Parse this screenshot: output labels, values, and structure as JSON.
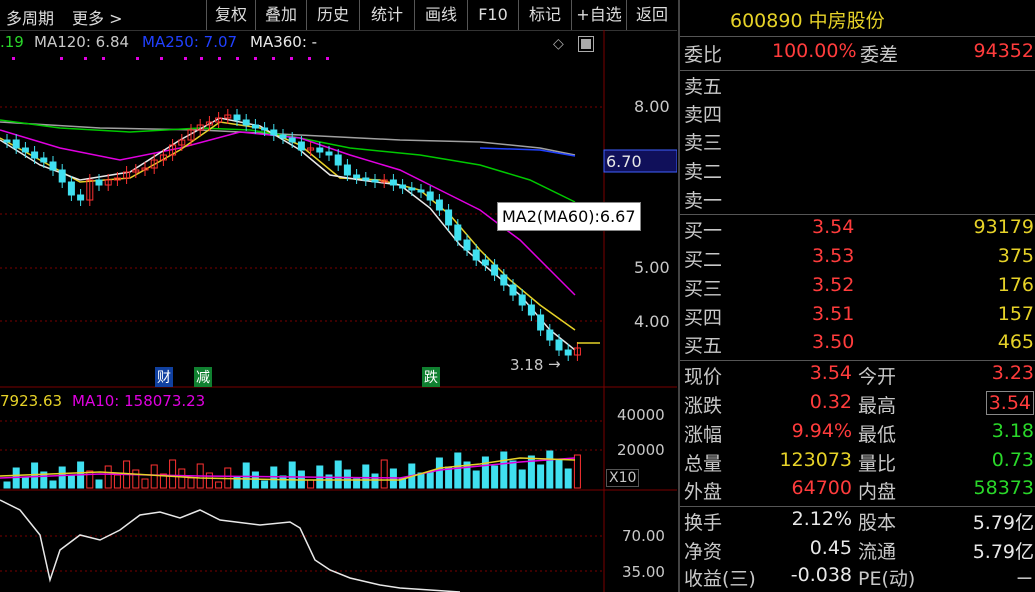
{
  "toolbar": {
    "period": "多周期",
    "more": "更多 >",
    "buttons": [
      "复权",
      "叠加",
      "历史",
      "统计",
      "画线",
      "F10",
      "标记",
      "+自选",
      "返回"
    ]
  },
  "chart": {
    "ma_values": {
      "ma120": "MA120: 6.84",
      "ma250": "MA250: 7.07",
      "ma360": "MA360: -",
      "left_partial": ".19"
    },
    "y_axis": [
      "8.00",
      "6.70",
      "5.00",
      "4.00"
    ],
    "current_price_tag": "6.70",
    "tooltip": "MA2(MA60):6.67",
    "low_marker": "3.18",
    "events": [
      "财",
      "减",
      "跌"
    ],
    "volume": {
      "left_partial": "7923.63",
      "ma10": "MA10: 158073.23",
      "axis": [
        "40000",
        "20000"
      ],
      "unit": "X10"
    },
    "indicator_axis": [
      "70.00",
      "35.00"
    ],
    "colors": {
      "up": "#ff3232",
      "down": "#40e0f0",
      "ma5": "#e8e8e8",
      "ma10": "#e6d228",
      "ma20": "#e000e0",
      "ma60": "#00c800",
      "ma120": "#a0a0a0"
    }
  },
  "panel": {
    "code_name": "600890 中房股份",
    "wei_bi_label": "委比",
    "wei_bi": "100.00%",
    "wei_cha_label": "委差",
    "wei_cha": "94352",
    "sell": [
      {
        "label": "卖五"
      },
      {
        "label": "卖四"
      },
      {
        "label": "卖三"
      },
      {
        "label": "卖二"
      },
      {
        "label": "卖一"
      }
    ],
    "buy": [
      {
        "label": "买一",
        "price": "3.54",
        "vol": "93179"
      },
      {
        "label": "买二",
        "price": "3.53",
        "vol": "375"
      },
      {
        "label": "买三",
        "price": "3.52",
        "vol": "176"
      },
      {
        "label": "买四",
        "price": "3.51",
        "vol": "157"
      },
      {
        "label": "买五",
        "price": "3.50",
        "vol": "465"
      }
    ],
    "stats": [
      {
        "l1": "现价",
        "v1": "3.54",
        "l2": "今开",
        "v2": "3.23"
      },
      {
        "l1": "涨跌",
        "v1": "0.32",
        "l2": "最高",
        "v2": "3.54"
      },
      {
        "l1": "涨幅",
        "v1": "9.94%",
        "l2": "最低",
        "v2": "3.18"
      },
      {
        "l1": "总量",
        "v1": "123073",
        "l2": "量比",
        "v2": "0.73"
      },
      {
        "l1": "外盘",
        "v1": "64700",
        "l2": "内盘",
        "v2": "58373"
      }
    ],
    "fund": [
      {
        "l1": "换手",
        "v1": "2.12%",
        "l2": "股本",
        "v2": "5.79亿"
      },
      {
        "l1": "净资",
        "v1": "0.45",
        "l2": "流通",
        "v2": "5.79亿"
      },
      {
        "l1": "收益(三)",
        "v1": "-0.038",
        "l2": "PE(动)",
        "v2": "－"
      }
    ]
  }
}
